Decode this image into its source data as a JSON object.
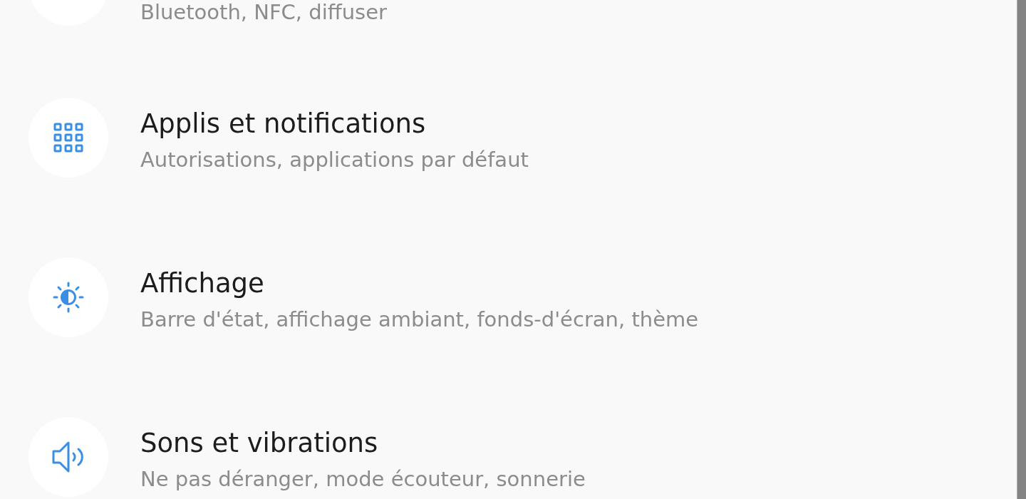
{
  "settings_list": [
    {
      "kind": "clipped",
      "subtitle": "Bluetooth, NFC, diffuser"
    },
    {
      "kind": "apps",
      "title": "Applis et notifications",
      "subtitle": "Autorisations, applications par défaut"
    },
    {
      "kind": "display",
      "title": "Affichage",
      "subtitle": "Barre d'état, affichage ambiant, fonds-d'écran, thème"
    },
    {
      "kind": "sound",
      "title": "Sons et vibrations",
      "subtitle": "Ne pas déranger, mode écouteur, sonnerie"
    }
  ]
}
